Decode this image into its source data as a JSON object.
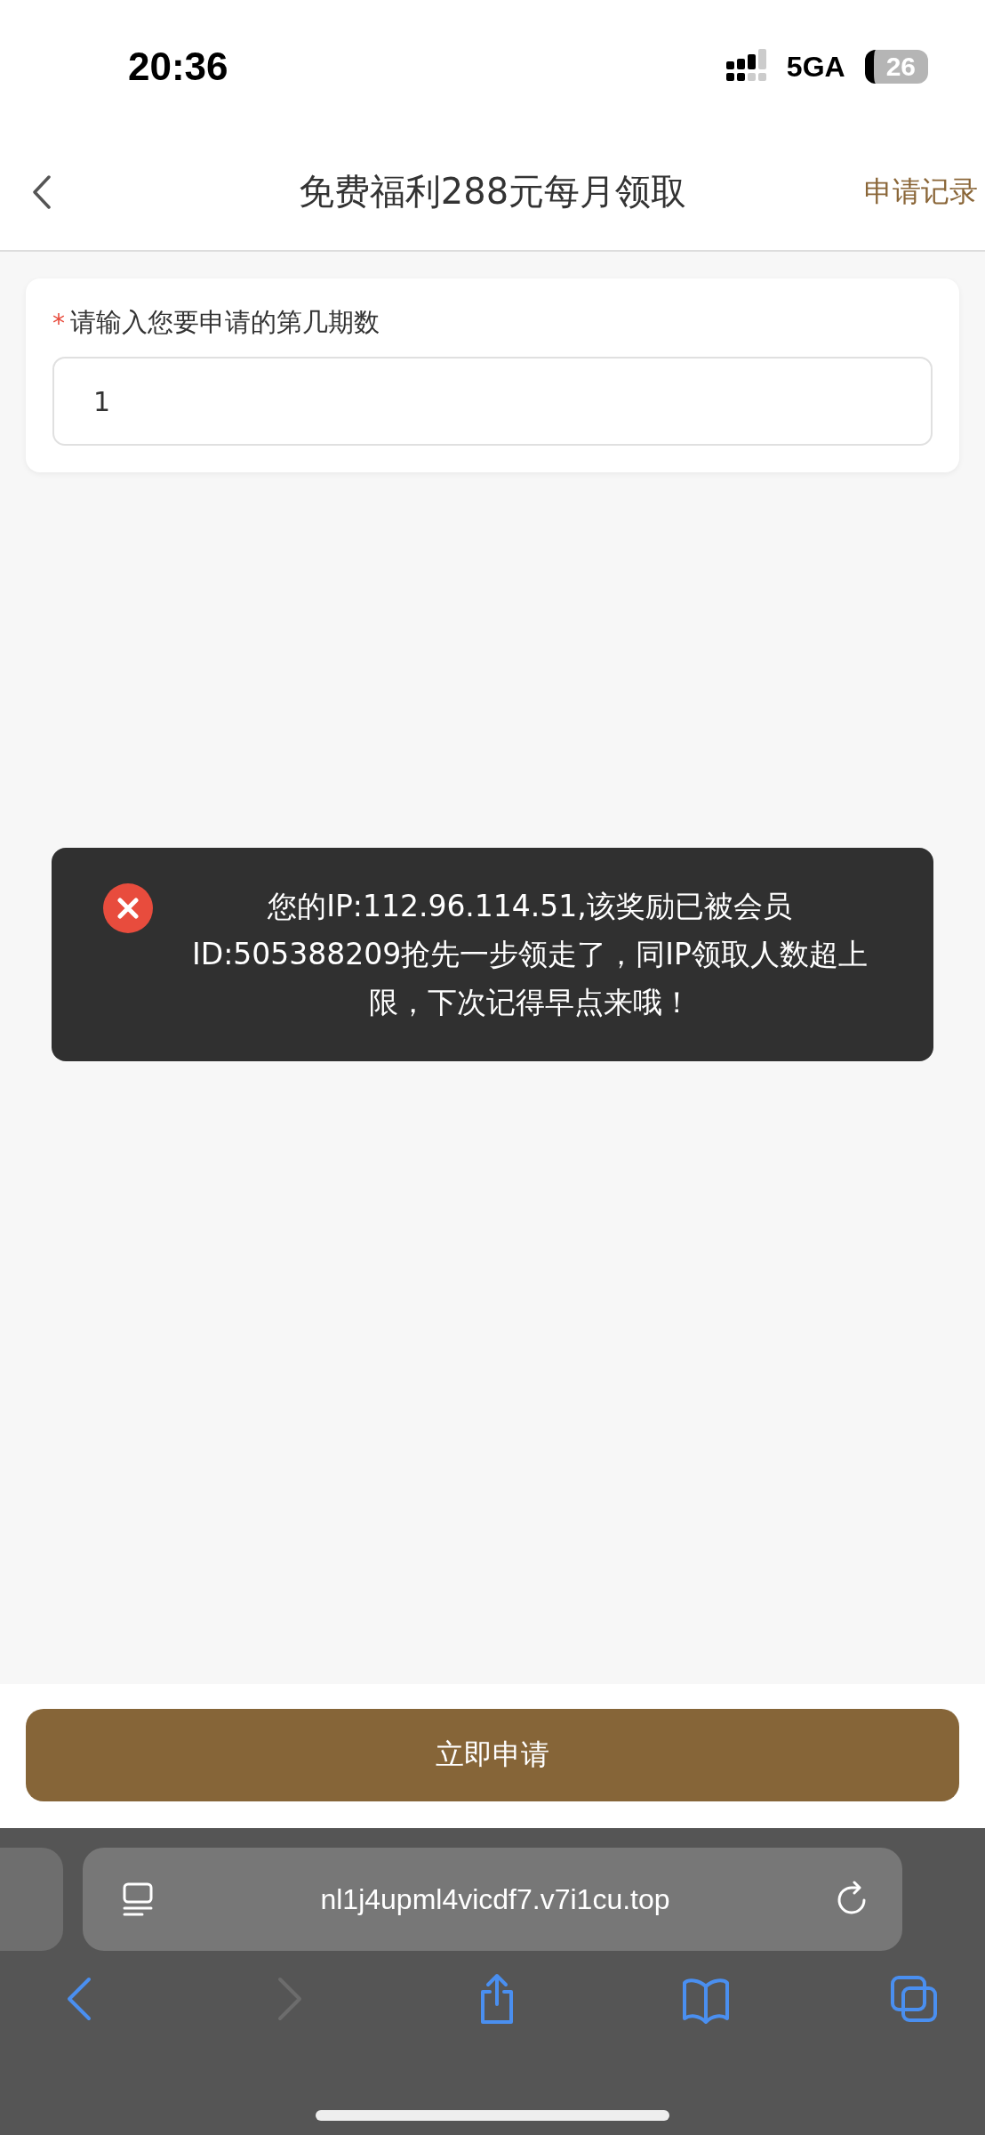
{
  "status_bar": {
    "time": "20:36",
    "network": "5GA",
    "battery": "26"
  },
  "header": {
    "title": "免费福利288元每月领取",
    "action": "申请记录"
  },
  "form": {
    "label": "请输入您要申请的第几期数",
    "required_mark": "*",
    "value": "1"
  },
  "toast": {
    "kind": "error",
    "message": "您的IP:112.96.114.51,该奖励已被会员ID:505388209抢先一步领走了，同IP领取人数超上限，下次记得早点来哦！"
  },
  "submit_button": "立即申请",
  "browser": {
    "url": "nl1j4upml4vicdf7.v7i1cu.top",
    "toolbar": [
      {
        "kind": "back",
        "disabled": false
      },
      {
        "kind": "forward",
        "disabled": true
      },
      {
        "kind": "share",
        "disabled": false
      },
      {
        "kind": "bookmarks",
        "disabled": false
      },
      {
        "kind": "tabs",
        "disabled": false
      }
    ]
  }
}
